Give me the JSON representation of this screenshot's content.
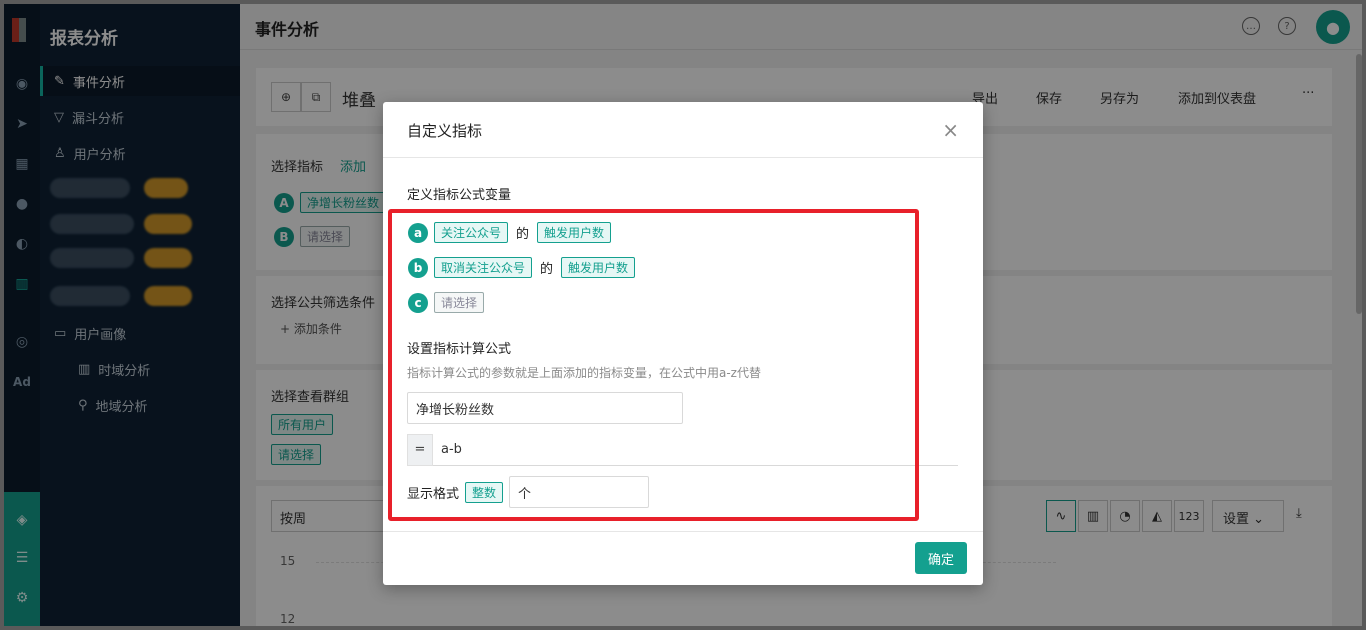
{
  "app": {
    "title": "报表分析"
  },
  "sidebar": {
    "items": [
      {
        "label": "事件分析",
        "active": true
      },
      {
        "label": "漏斗分析"
      },
      {
        "label": "用户分析"
      },
      {
        "label": "用户画像"
      },
      {
        "label": "时域分析"
      },
      {
        "label": "地域分析"
      }
    ],
    "ad_label": "Ad"
  },
  "header": {
    "title": "事件分析"
  },
  "toolbar": {
    "chart_kind": "堆叠",
    "export": "导出",
    "save": "保存",
    "save_as": "另存为",
    "add_dashboard": "添加到仪表盘",
    "more": "···"
  },
  "main": {
    "select_metric": "选择指标",
    "add_label": "添加",
    "metric_a": "净增长粉丝数",
    "metric_b": "请选择",
    "filter_title": "选择公共筛选条件",
    "add_condition": "添加条件",
    "group_title": "选择查看群组",
    "all_users": "所有用户",
    "please_select": "请选择",
    "period": "按周",
    "settings": "设置",
    "y_ticks": [
      "15",
      "12"
    ],
    "count_label": "123"
  },
  "modal": {
    "title": "自定义指标",
    "variables_title": "定义指标公式变量",
    "variables": [
      {
        "letter": "a",
        "event": "关注公众号",
        "connector": "的",
        "measure": "触发用户数"
      },
      {
        "letter": "b",
        "event": "取消关注公众号",
        "connector": "的",
        "measure": "触发用户数"
      },
      {
        "letter": "c",
        "event": "请选择"
      }
    ],
    "formula_title": "设置指标计算公式",
    "formula_hint": "指标计算公式的参数就是上面添加的指标变量，在公式中用a-z代替",
    "metric_name": "净增长粉丝数",
    "eq_sign": "=",
    "formula": "a-b",
    "format_label": "显示格式",
    "format_type": "整数",
    "unit": "个",
    "confirm": "确定",
    "close_icon": "×"
  },
  "colors": {
    "accent": "#14a08f",
    "highlight": "#e8202a"
  }
}
